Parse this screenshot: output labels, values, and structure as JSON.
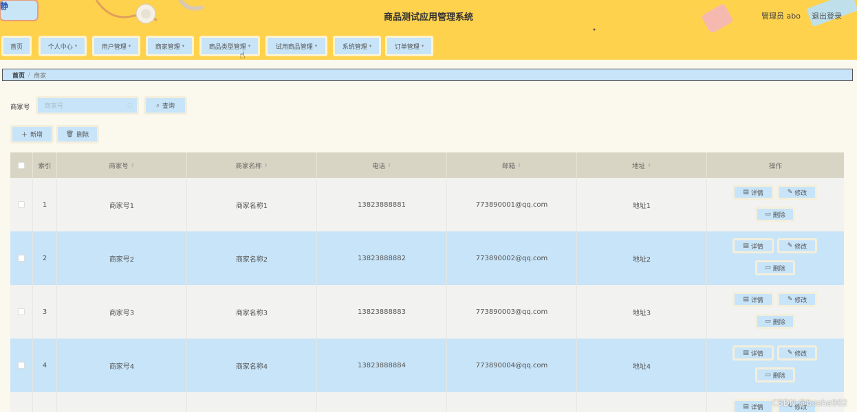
{
  "header": {
    "brand": "静",
    "title": "商品测试应用管理系统",
    "admin": "管理员 abo",
    "logout": "退出登录"
  },
  "nav": [
    {
      "label": "首页",
      "caret": false
    },
    {
      "label": "个人中心",
      "caret": true
    },
    {
      "label": "用户管理",
      "caret": true
    },
    {
      "label": "商家管理",
      "caret": true
    },
    {
      "label": "商品类型管理",
      "caret": true
    },
    {
      "label": "试用商品管理",
      "caret": true
    },
    {
      "label": "系统管理",
      "caret": true
    },
    {
      "label": "订单管理",
      "caret": true
    }
  ],
  "breadcrumb": {
    "home": "首页",
    "sep": "/",
    "current": "商家"
  },
  "search": {
    "label": "商家号",
    "placeholder": "商家号",
    "button": "查询"
  },
  "toolbar": {
    "add": "新增",
    "delete": "删除"
  },
  "table": {
    "columns": [
      "索引",
      "商家号",
      "商家名称",
      "电话",
      "邮箱",
      "地址",
      "操作"
    ],
    "rows": [
      {
        "index": "1",
        "id": "商家号1",
        "name": "商家名称1",
        "phone": "13823888881",
        "email": "773890001@qq.com",
        "addr": "地址1"
      },
      {
        "index": "2",
        "id": "商家号2",
        "name": "商家名称2",
        "phone": "13823888882",
        "email": "773890002@qq.com",
        "addr": "地址2"
      },
      {
        "index": "3",
        "id": "商家号3",
        "name": "商家名称3",
        "phone": "13823888883",
        "email": "773890003@qq.com",
        "addr": "地址3"
      },
      {
        "index": "4",
        "id": "商家号4",
        "name": "商家名称4",
        "phone": "13823888884",
        "email": "773890004@qq.com",
        "addr": "地址4"
      }
    ],
    "actions": {
      "detail": "详情",
      "edit": "修改",
      "delete": "删除"
    }
  },
  "watermark": "CSDN @bushe902",
  "icons": {
    "search": "search-icon",
    "plus": "plus-icon",
    "trash": "trash-icon",
    "doc": "doc-icon",
    "edit": "edit-icon"
  }
}
